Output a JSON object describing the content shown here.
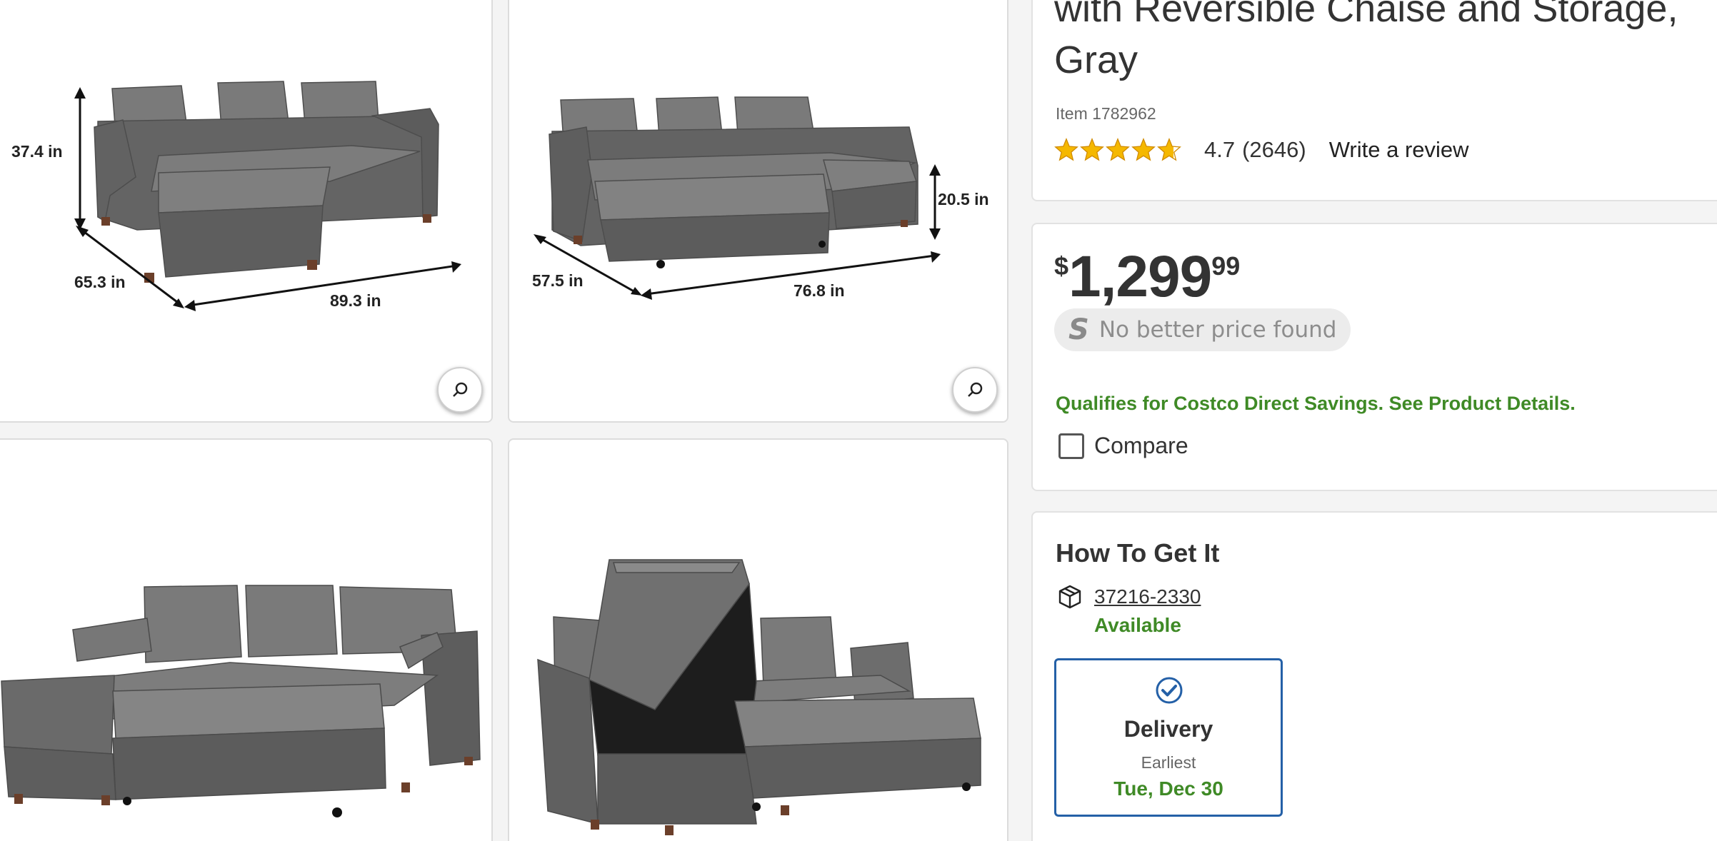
{
  "product": {
    "title": "with Reversible Chaise and Storage, Gray",
    "item_number": "Item 1782962",
    "rating": {
      "value": "4.7",
      "count": "(2646)",
      "stars_out_of_5": 4.7,
      "write_review_label": "Write a review"
    }
  },
  "pricing": {
    "currency_symbol": "$",
    "price_main": "1,299",
    "price_cents": "99",
    "no_better_price_logo": "S",
    "no_better_price_text": "No better price found",
    "savings_link": "Qualifies for Costco Direct Savings. See Product Details.",
    "compare_label": "Compare"
  },
  "fulfillment": {
    "title": "How To Get It",
    "zip_code": "37216-2330",
    "availability": "Available",
    "delivery": {
      "title": "Delivery",
      "subtitle": "Earliest",
      "date": "Tue, Dec 30"
    }
  },
  "gallery": {
    "image1": {
      "height_label": "37.4 in",
      "depth_label": "65.3 in",
      "width_label": "89.3 in"
    },
    "image2": {
      "height_label": "20.5 in",
      "depth_label": "57.5 in",
      "width_label": "76.8 in"
    }
  },
  "icons": [
    "zoom-icon",
    "star-icon",
    "package-icon",
    "checkmark-circle-icon"
  ],
  "colors": {
    "accent_green": "#3f8a26",
    "accent_blue": "#2460a7",
    "star": "#f5b800",
    "text": "#333333"
  }
}
